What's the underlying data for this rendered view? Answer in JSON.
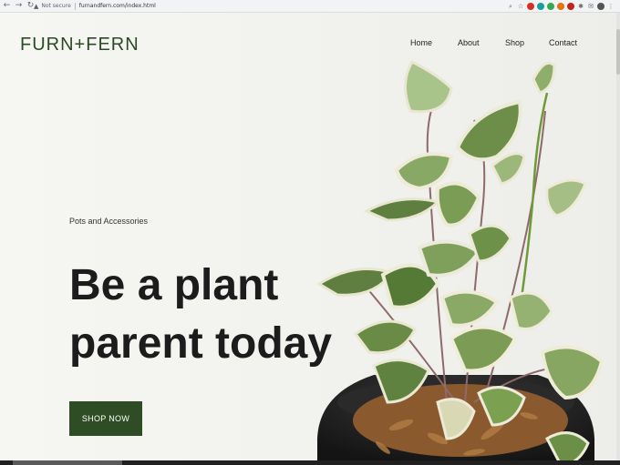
{
  "browser": {
    "security_label": "Not secure",
    "url": "furnandfern.com/index.html",
    "extensions": [
      {
        "name": "search-icon",
        "glyph": "⌕",
        "color": "#666666"
      },
      {
        "name": "star-icon",
        "glyph": "☆",
        "color": "#666666"
      },
      {
        "name": "red-extension-icon",
        "glyph": "",
        "color": "#d93025"
      },
      {
        "name": "teal-extension-icon",
        "glyph": "",
        "color": "#1a9e9e"
      },
      {
        "name": "green-extension-icon",
        "glyph": "",
        "color": "#34a853"
      },
      {
        "name": "orange-extension-icon",
        "glyph": "",
        "color": "#e8710a"
      },
      {
        "name": "opera-extension-icon",
        "glyph": "",
        "color": "#c5221f"
      },
      {
        "name": "puzzle-icon",
        "glyph": "✱",
        "color": "#666666"
      },
      {
        "name": "mail-extension-icon",
        "glyph": "✉",
        "color": "#666666"
      },
      {
        "name": "profile-avatar-icon",
        "glyph": "",
        "color": "#555555"
      },
      {
        "name": "menu-icon",
        "glyph": "⋮",
        "color": "#666666"
      }
    ]
  },
  "site": {
    "logo": "FURN+FERN",
    "nav": [
      "Home",
      "About",
      "Shop",
      "Contact"
    ]
  },
  "hero": {
    "eyebrow": "Pots and Accessories",
    "headline_line1": "Be a plant",
    "headline_line2": "parent today",
    "cta_label": "SHOP NOW"
  },
  "colors": {
    "brand_green": "#2e4d24",
    "logo_green": "#2c4a25",
    "text_dark": "#1c1c1c"
  }
}
